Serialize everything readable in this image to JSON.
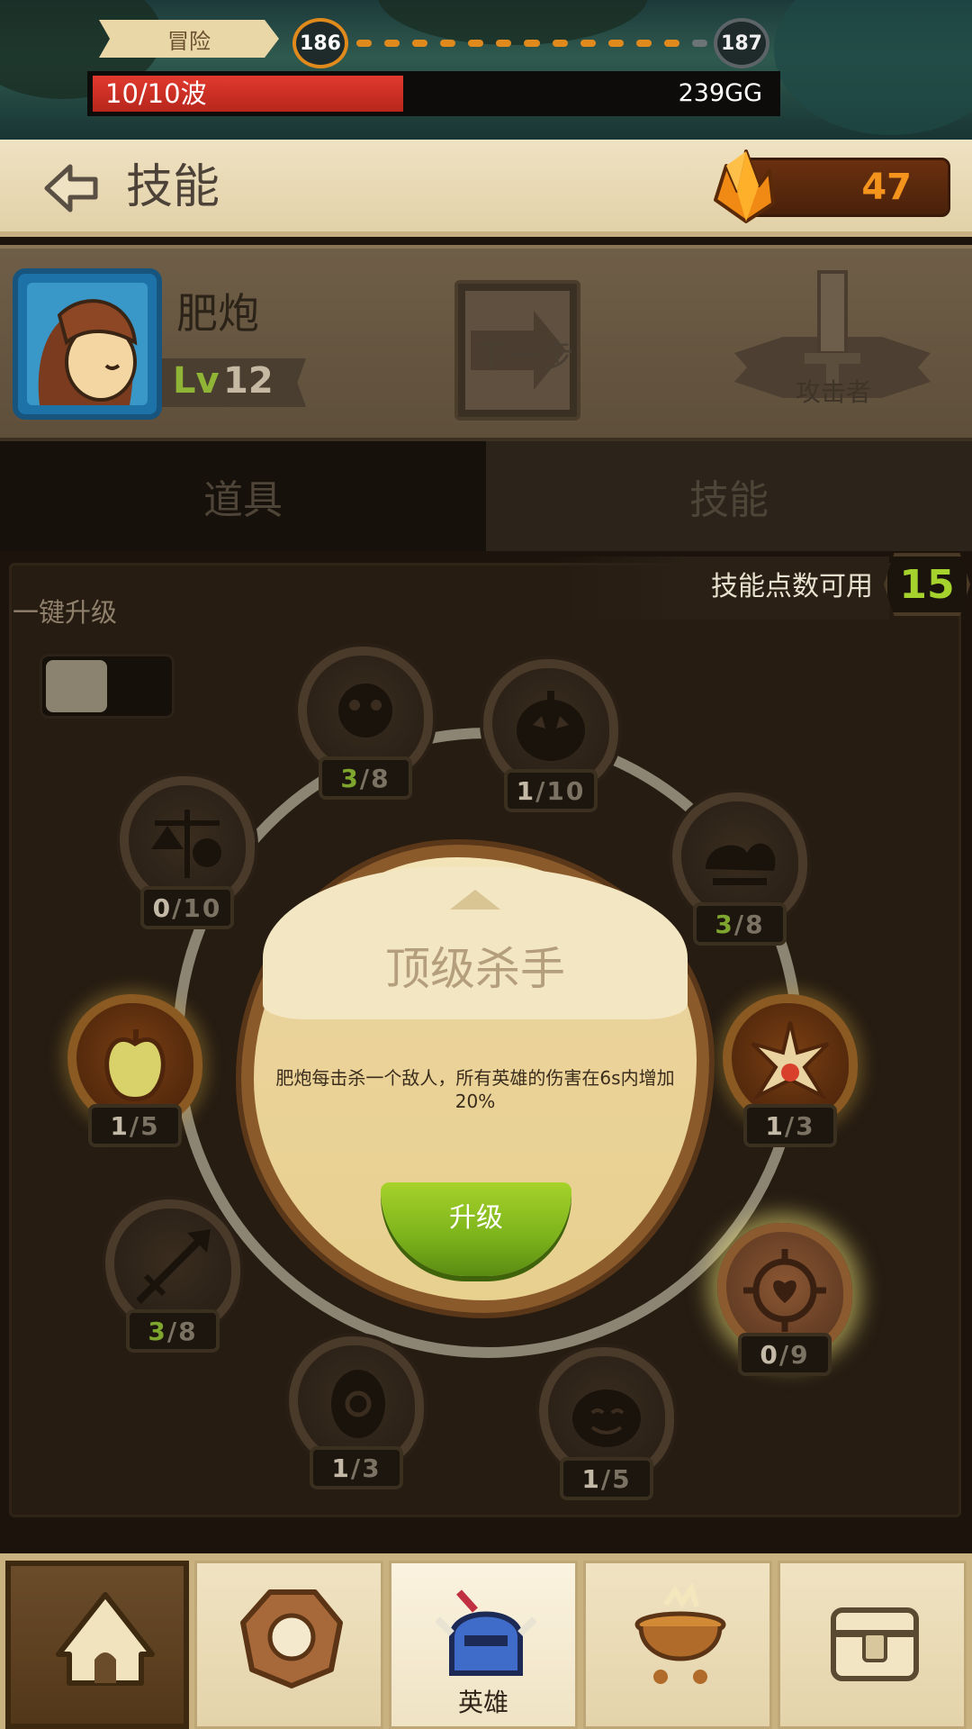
{
  "top": {
    "mode_label": "冒险",
    "current_level": "186",
    "next_level": "187",
    "wave_text": "10/10波",
    "gold_text": "239GG",
    "path_dots_done": 12,
    "path_dots_total": 13,
    "colors": {
      "progress": "#e08a1e",
      "wave_fill": "#e23a2e"
    }
  },
  "header": {
    "title": "技能",
    "back_icon": "back-arrow-icon",
    "gem_count": "47",
    "gem_icon": "crystal-icon"
  },
  "hero": {
    "name": "肥炮",
    "lv_label": "Lv",
    "level": "12",
    "next_button": "下一步",
    "class_label": "攻击者",
    "class_icon": "sword-icon"
  },
  "tabs": [
    {
      "label": "道具"
    },
    {
      "label": "技能"
    }
  ],
  "skills_panel": {
    "points_label": "技能点数可用",
    "points_value": "15",
    "quick_upgrade_label": "一键升级",
    "quick_upgrade_on": false
  },
  "skill_nodes": [
    {
      "icon": "gorilla-icon",
      "current": "3",
      "max": "/8",
      "green": true
    },
    {
      "icon": "pumpkin-icon",
      "current": "1",
      "max": "/10",
      "green": false
    },
    {
      "icon": "scales-icon",
      "current": "0",
      "max": "/10",
      "green": false
    },
    {
      "icon": "storm-cloud-icon",
      "current": "3",
      "max": "/8",
      "green": true
    },
    {
      "icon": "apple-icon",
      "current": "1",
      "max": "/5",
      "green": false
    },
    {
      "icon": "explosion-icon",
      "current": "1",
      "max": "/3",
      "green": false
    },
    {
      "icon": "arrow-icon",
      "current": "3",
      "max": "/8",
      "green": true
    },
    {
      "icon": "heart-target-icon",
      "current": "0",
      "max": "/9",
      "green": false
    },
    {
      "icon": "spiral-egg-icon",
      "current": "1",
      "max": "/3",
      "green": false
    },
    {
      "icon": "smiling-face-icon",
      "current": "1",
      "max": "/5",
      "green": false
    }
  ],
  "popup": {
    "title": "顶级杀手",
    "description": "肥炮每击杀一个敌人，所有英雄的伤害在6s内增加20%",
    "upgrade_label": "升级"
  },
  "nav": [
    {
      "icon": "camp-tent-icon",
      "label": ""
    },
    {
      "icon": "wooden-shield-icon",
      "label": ""
    },
    {
      "icon": "knight-helmet-icon",
      "label": "英雄"
    },
    {
      "icon": "cauldron-icon",
      "label": ""
    },
    {
      "icon": "treasure-chest-icon",
      "label": ""
    }
  ]
}
